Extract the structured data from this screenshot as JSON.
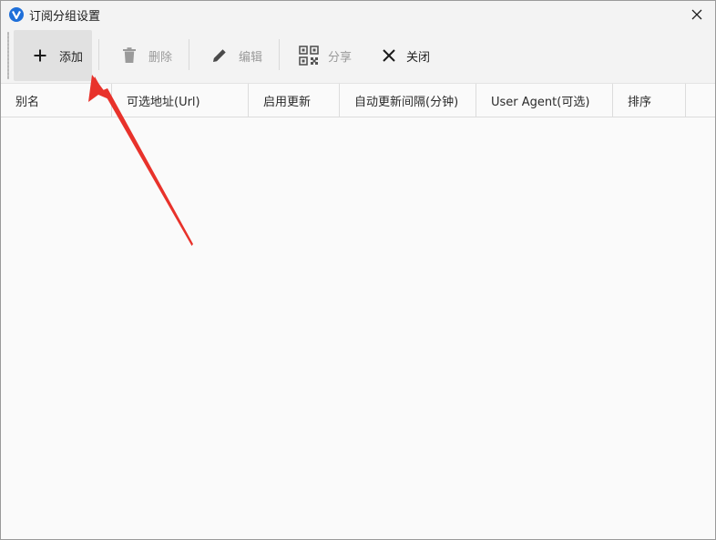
{
  "window": {
    "title": "订阅分组设置",
    "icon": "app-v-logo-icon",
    "close_icon": "close-icon"
  },
  "toolbar": {
    "add_label": "添加",
    "delete_label": "删除",
    "edit_label": "编辑",
    "share_label": "分享",
    "close_label": "关闭"
  },
  "table": {
    "columns": [
      "别名",
      "可选地址(Url)",
      "启用更新",
      "自动更新间隔(分钟)",
      "User Agent(可选)",
      "排序"
    ],
    "rows": []
  },
  "colors": {
    "accent_icon": "#1e6fd9",
    "annotation_arrow": "#e8322b",
    "toolbar_bg": "#f3f3f3",
    "active_button_bg": "#e1e1e1"
  }
}
